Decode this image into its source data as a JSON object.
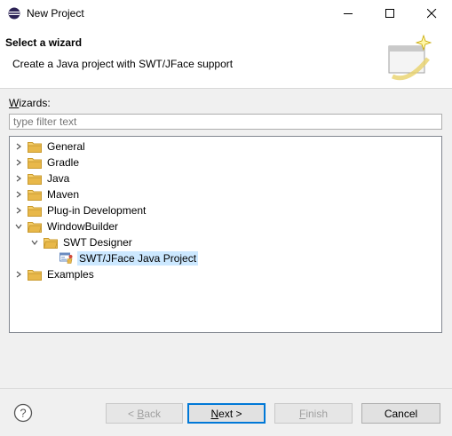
{
  "window": {
    "title": "New Project",
    "icon": "eclipse-icon",
    "controls": [
      "minimize-icon",
      "maximize-icon",
      "close-icon"
    ]
  },
  "banner": {
    "title": "Select a wizard",
    "description": "Create a Java project with SWT/JFace support",
    "image": "wizard-banner-icon"
  },
  "wizards": {
    "label_prefix": "W",
    "label_rest": "izards:",
    "filter_placeholder": "type filter text"
  },
  "tree": {
    "items": [
      {
        "label": "General",
        "expanded": false,
        "icon": "folder-icon"
      },
      {
        "label": "Gradle",
        "expanded": false,
        "icon": "folder-icon"
      },
      {
        "label": "Java",
        "expanded": false,
        "icon": "folder-icon"
      },
      {
        "label": "Maven",
        "expanded": false,
        "icon": "folder-icon"
      },
      {
        "label": "Plug-in Development",
        "expanded": false,
        "icon": "folder-icon"
      },
      {
        "label": "WindowBuilder",
        "expanded": true,
        "icon": "folder-icon"
      },
      {
        "label": "SWT Designer",
        "expanded": true,
        "icon": "folder-icon"
      },
      {
        "label": "SWT/JFace Java Project",
        "selected": true,
        "icon": "swt-project-icon"
      },
      {
        "label": "Examples",
        "expanded": false,
        "icon": "folder-icon"
      }
    ]
  },
  "buttons": {
    "help": "help-icon",
    "back_pre": "< ",
    "back_mn": "B",
    "back_rest": "ack",
    "next_mn": "N",
    "next_rest": "ext >",
    "finish_mn": "F",
    "finish_rest": "inish",
    "cancel": "Cancel"
  },
  "colors": {
    "selection": "#cce8ff",
    "default_button_border": "#0078d7",
    "folder": "#e8b84a"
  }
}
